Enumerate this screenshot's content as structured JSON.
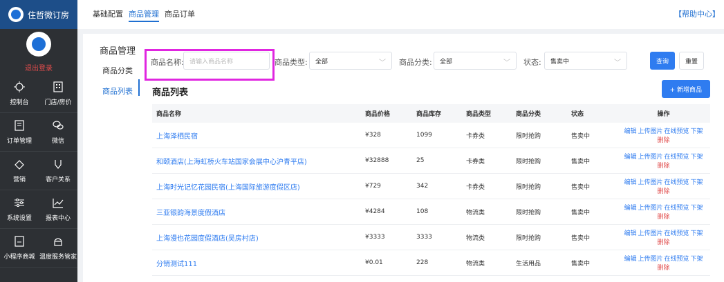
{
  "sidebar": {
    "brand": "住哲微订房",
    "logout": "退出登录",
    "items": [
      {
        "label": "控制台",
        "icon": "dashboard-icon"
      },
      {
        "label": "门店/房价",
        "icon": "building-icon"
      },
      {
        "label": "订单管理",
        "icon": "order-icon"
      },
      {
        "label": "微信",
        "icon": "wechat-icon"
      },
      {
        "label": "营销",
        "icon": "marketing-icon"
      },
      {
        "label": "客户关系",
        "icon": "customer-icon"
      },
      {
        "label": "系统设置",
        "icon": "settings-icon"
      },
      {
        "label": "报表中心",
        "icon": "chart-icon"
      },
      {
        "label": "小程序商城",
        "icon": "mini-program-icon"
      },
      {
        "label": "温度服务管家",
        "icon": "service-icon"
      }
    ]
  },
  "topbar": {
    "tabs": [
      "基础配置",
      "商品管理",
      "商品订单"
    ],
    "active_tab": 1,
    "help": "【帮助中心】"
  },
  "left_nav": {
    "title": "商品管理",
    "category": "商品分类",
    "list": "商品列表"
  },
  "filter": {
    "name_label": "商品名称:",
    "name_placeholder": "请输入商品名称",
    "type_label": "商品类型:",
    "type_value": "全部",
    "category_label": "商品分类:",
    "category_value": "全部",
    "status_label": "状态:",
    "status_value": "售卖中",
    "search_btn": "查询",
    "reset_btn": "重置"
  },
  "list": {
    "title": "商品列表",
    "add_btn": "+ 新增商品",
    "columns": [
      "商品名称",
      "商品价格",
      "商品库存",
      "商品类型",
      "商品分类",
      "状态",
      "操作"
    ],
    "rows": [
      {
        "name": "上海泽栖民宿",
        "price": "¥328",
        "stock": "1099",
        "type": "卡券类",
        "category": "限时抢购",
        "status": "售卖中"
      },
      {
        "name": "和颐酒店(上海虹桥火车站国家会展中心沪青平店)",
        "price": "¥32888",
        "stock": "25",
        "type": "卡券类",
        "category": "限时抢购",
        "status": "售卖中"
      },
      {
        "name": "上海时光记忆花园民宿(上海国际旅游度假区店)",
        "price": "¥729",
        "stock": "342",
        "type": "卡券类",
        "category": "限时抢购",
        "status": "售卖中"
      },
      {
        "name": "三亚银韵海景度假酒店",
        "price": "¥4284",
        "stock": "108",
        "type": "物流类",
        "category": "限时抢购",
        "status": "售卖中"
      },
      {
        "name": "上海漫也花园度假酒店(吴房村店)",
        "price": "¥3333",
        "stock": "3333",
        "type": "物流类",
        "category": "限时抢购",
        "status": "售卖中"
      },
      {
        "name": "分销测试111",
        "price": "¥0.01",
        "stock": "228",
        "type": "物流类",
        "category": "生活用品",
        "status": "售卖中"
      }
    ],
    "ops": {
      "edit": "编辑",
      "upload": "上传图片",
      "preview": "在线预览",
      "offline": "下架",
      "delete": "删除"
    }
  }
}
